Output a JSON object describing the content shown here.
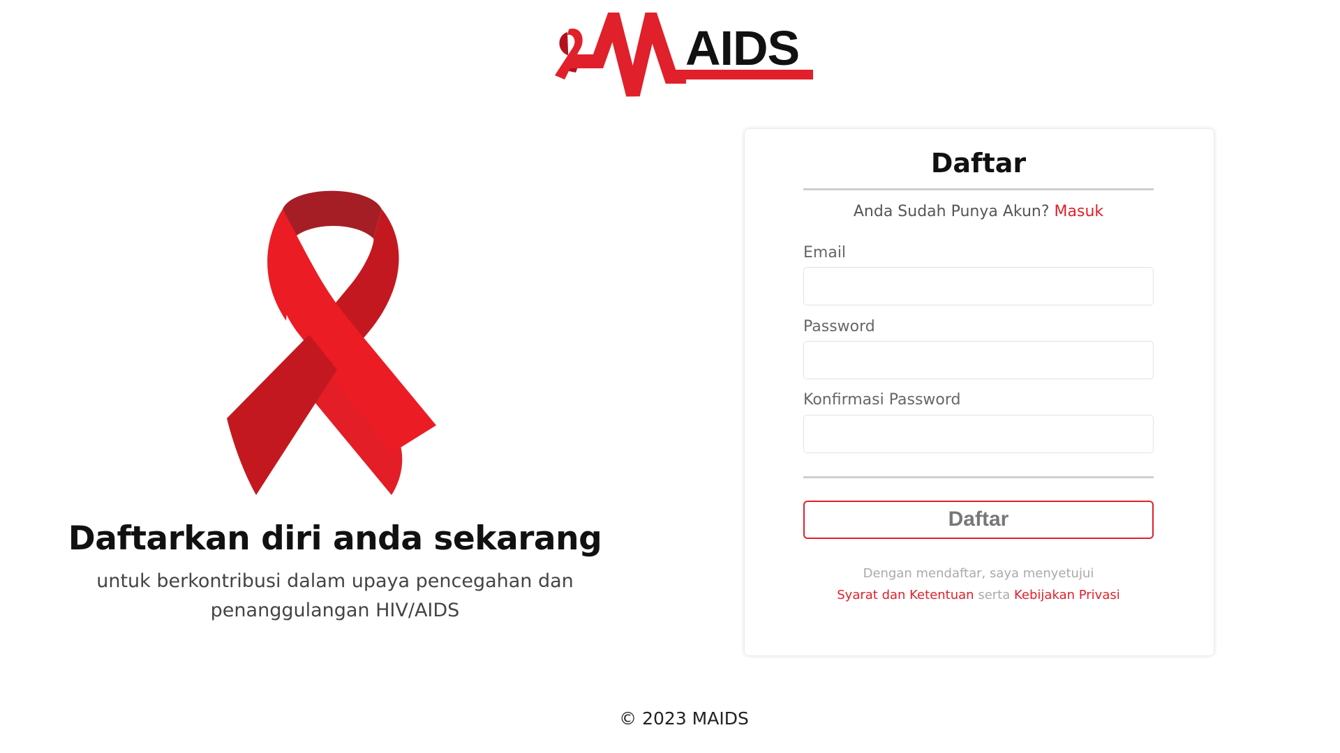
{
  "brand": {
    "logo_text": "AIDS",
    "accent_color": "#e0202a"
  },
  "hero": {
    "title": "Daftarkan diri anda sekarang",
    "subtitle_line1": "untuk berkontribusi dalam upaya pencegahan dan",
    "subtitle_line2": "penanggulangan HIV/AIDS",
    "image_icon": "red-ribbon-icon"
  },
  "form": {
    "title": "Daftar",
    "have_account_text": "Anda Sudah Punya Akun?",
    "login_link": "Masuk",
    "fields": [
      {
        "label": "Email",
        "value": "",
        "placeholder": ""
      },
      {
        "label": "Password",
        "value": "",
        "placeholder": ""
      },
      {
        "label": "Konfirmasi Password",
        "value": "",
        "placeholder": ""
      }
    ],
    "submit_label": "Daftar",
    "terms_prefix": "Dengan mendaftar, saya menyetujui",
    "terms_link": "Syarat dan Ketentuan",
    "terms_joiner": "serta",
    "privacy_link": "Kebijakan Privasi"
  },
  "footer": {
    "copyright": "© 2023 MAIDS"
  }
}
